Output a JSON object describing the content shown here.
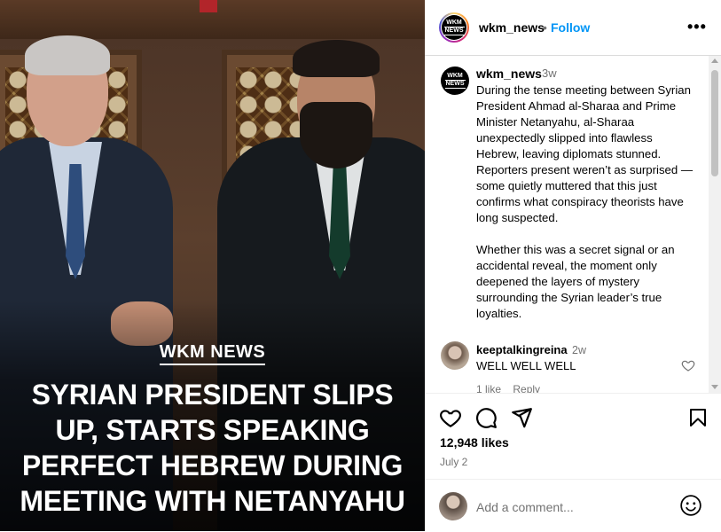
{
  "post": {
    "brand": "WKM NEWS",
    "headline": "SYRIAN PRESIDENT SLIPS UP, STARTS SPEAKING PERFECT HEBREW DURING MEETING WITH NETANYAHU"
  },
  "header": {
    "logo_text_top": "WKM",
    "logo_text_bottom": "NEWS",
    "username": "wkm_news",
    "separator": "•",
    "follow": "Follow",
    "more": "•••"
  },
  "caption": {
    "username": "wkm_news",
    "time": "3w",
    "paragraph1": "During the tense meeting between Syrian President Ahmad al-Sharaa and Prime Minister Netanyahu, al-Sharaa unexpectedly slipped into flawless Hebrew, leaving diplomats stunned. Reporters present weren’t as surprised — some quietly muttered that this just confirms what conspiracy theorists have long suspected.",
    "paragraph2": "Whether this was a secret signal or an accidental reveal, the moment only deepened the layers of mystery surrounding the Syrian leader’s true loyalties."
  },
  "comment": {
    "username": "keeptalkingreina",
    "time": "2w",
    "text": "WELL WELL WELL",
    "likes": "1 like",
    "reply": "Reply"
  },
  "actions": {
    "likes": "12,948 likes",
    "date": "July 2"
  },
  "add_comment": {
    "placeholder": "Add a comment..."
  },
  "icons": [
    "heart-icon",
    "comment-icon",
    "share-icon",
    "bookmark-icon",
    "emoji-icon",
    "more-icon"
  ],
  "colors": {
    "link": "#0095f6",
    "muted": "#737373",
    "border": "#dbdbdb"
  }
}
